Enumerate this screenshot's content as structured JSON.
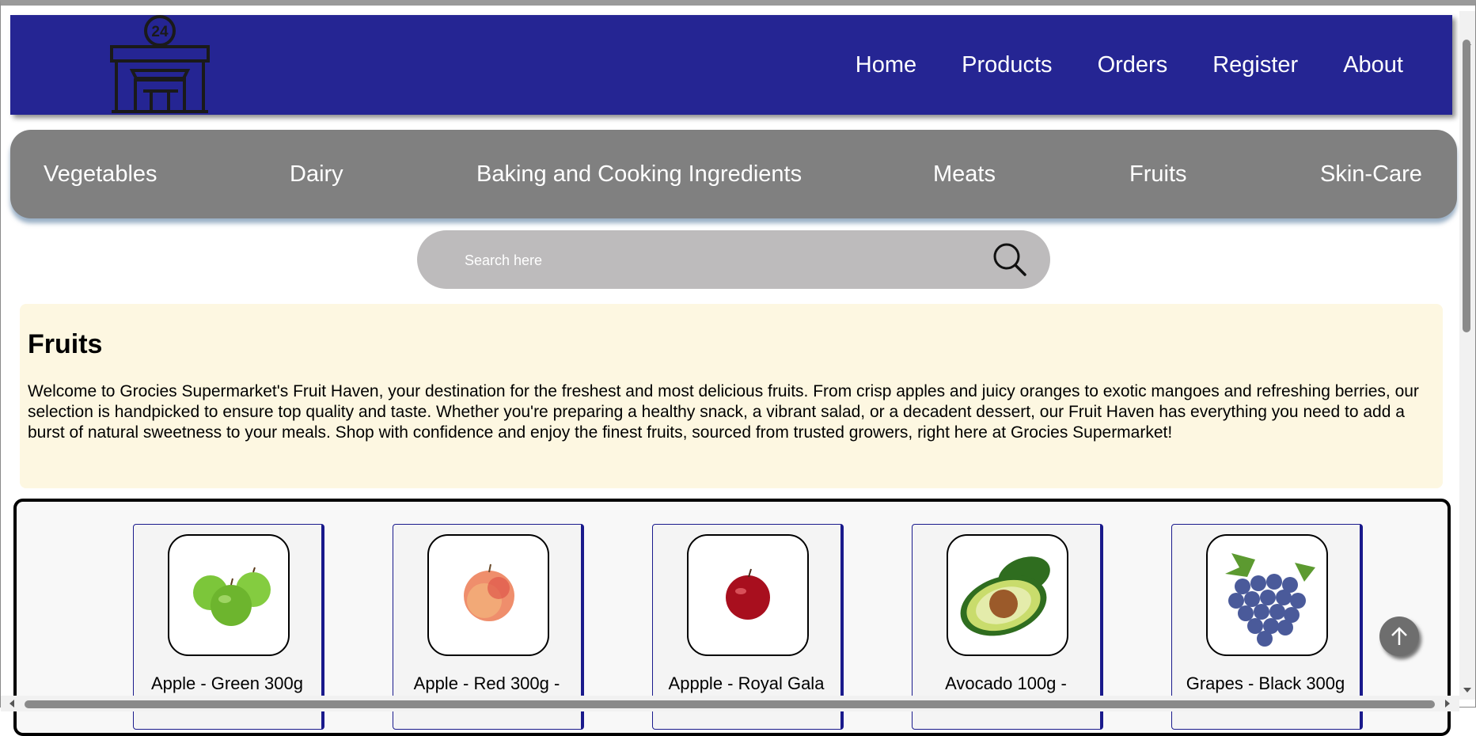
{
  "header": {
    "logo_text": "24",
    "nav": [
      "Home",
      "Products",
      "Orders",
      "Register",
      "About"
    ]
  },
  "categories": [
    "Vegetables",
    "Dairy",
    "Baking and Cooking Ingredients",
    "Meats",
    "Fruits",
    "Skin-Care"
  ],
  "search": {
    "placeholder": "Search here",
    "icon": "search-icon"
  },
  "intro": {
    "title": "Fruits",
    "text": "Welcome to Grocies Supermarket's Fruit Haven, your destination for the freshest and most delicious fruits. From crisp apples and juicy oranges to exotic mangoes and refreshing berries, our selection is handpicked to ensure top quality and taste. Whether you're preparing a healthy snack, a vibrant salad, or a decadent dessert, our Fruit Haven has everything you need to add a burst of natural sweetness to your meals. Shop with confidence and enjoy the finest fruits, sourced from trusted growers, right here at Grocies Supermarket!"
  },
  "products": [
    {
      "title": "Apple - Green 300g",
      "image": "green-apples-image"
    },
    {
      "title": "Apple - Red 300g -",
      "image": "red-apple-image"
    },
    {
      "title": "Appple - Royal Gala",
      "image": "royal-gala-apple-image"
    },
    {
      "title": "Avocado 100g -",
      "image": "avocado-image"
    },
    {
      "title": "Grapes - Black 300g",
      "image": "black-grapes-image"
    }
  ],
  "colors": {
    "header_bg": "#252593",
    "category_bg": "#808080",
    "search_bg": "#bdbbbc",
    "intro_bg": "#fdf7e1",
    "card_border": "#1a1a8c"
  },
  "icons": {
    "back_to_top": "arrow-up-icon"
  }
}
